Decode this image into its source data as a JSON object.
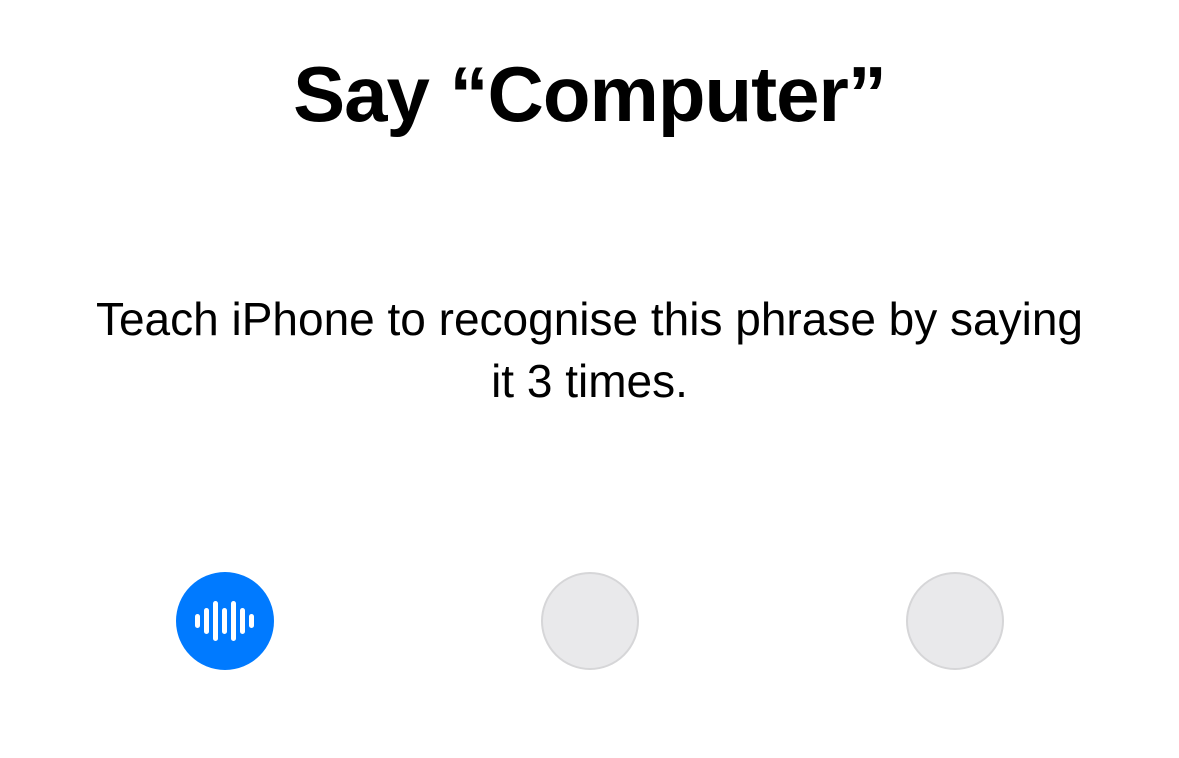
{
  "title": "Say “Computer”",
  "subtitle": "Teach iPhone to recognise this phrase by saying it 3 times.",
  "indicators": {
    "total": 3,
    "current": 1,
    "icon_name": "waveform-icon"
  },
  "colors": {
    "accent": "#007aff",
    "inactive_fill": "#e9e9eb",
    "inactive_border": "#d6d6d8",
    "text": "#000000",
    "background": "#ffffff"
  }
}
